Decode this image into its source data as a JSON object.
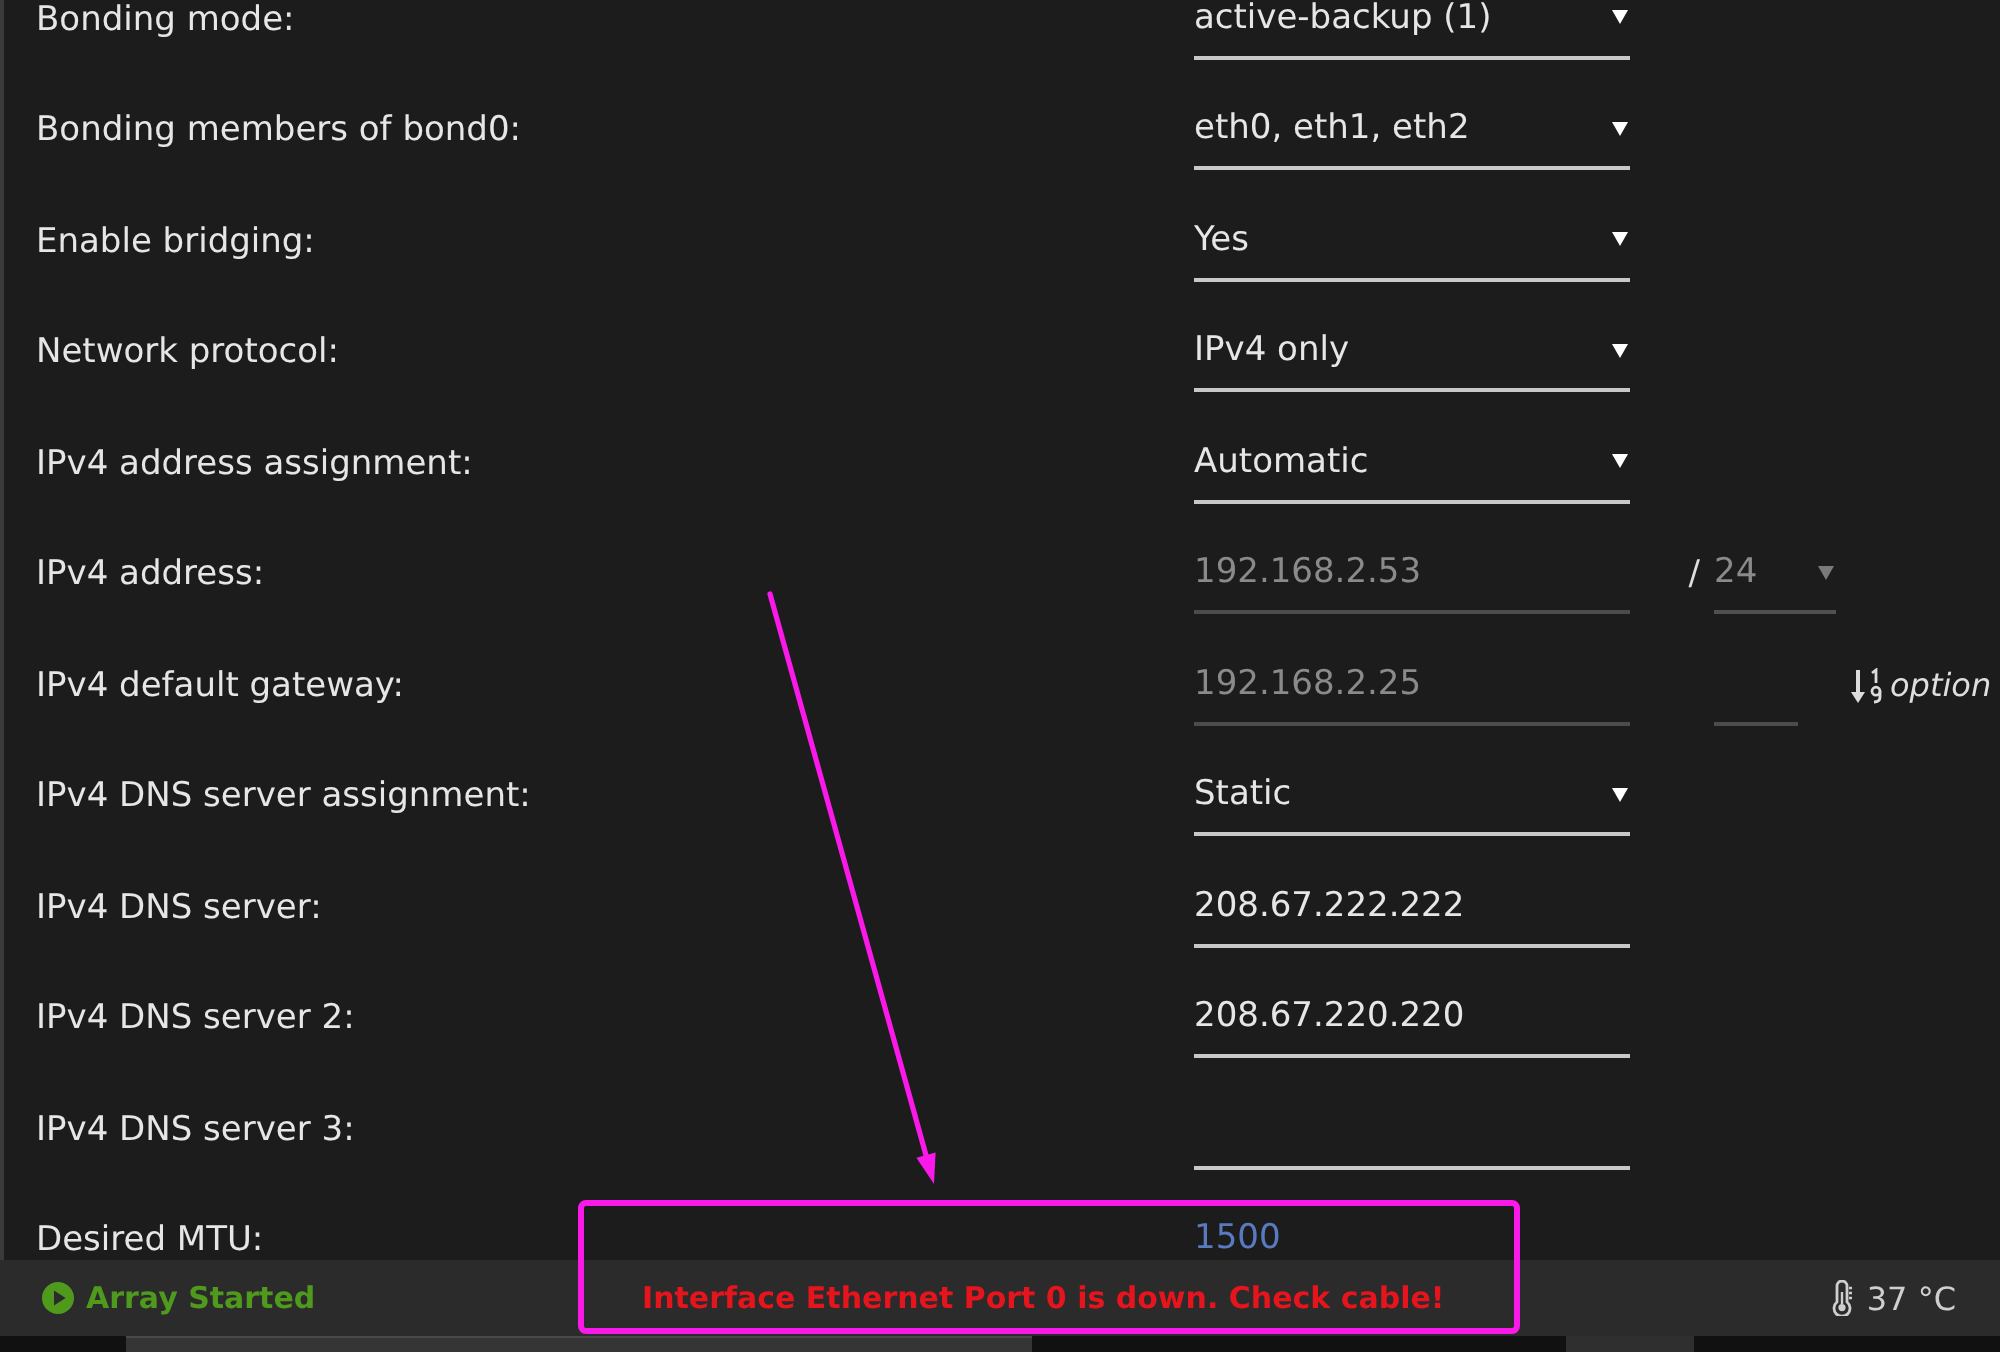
{
  "fields": [
    {
      "label": "Bonding mode:",
      "kind": "select",
      "value": "active-backup (1)",
      "disabled": false
    },
    {
      "label": "Bonding members of bond0:",
      "kind": "select",
      "value": "eth0, eth1, eth2",
      "disabled": false
    },
    {
      "label": "Enable bridging:",
      "kind": "select",
      "value": "Yes",
      "disabled": false
    },
    {
      "label": "Network protocol:",
      "kind": "select",
      "value": "IPv4 only",
      "disabled": false
    },
    {
      "label": "IPv4 address assignment:",
      "kind": "select",
      "value": "Automatic",
      "disabled": false
    },
    {
      "label": "IPv4 address:",
      "kind": "input",
      "value": "192.168.2.53",
      "disabled": true,
      "extras": [
        {
          "kind": "text",
          "text": "/"
        },
        {
          "kind": "select",
          "value": "24",
          "disabled": true
        }
      ]
    },
    {
      "label": "IPv4 default gateway:",
      "kind": "input",
      "value": "192.168.2.25",
      "disabled": true,
      "extras": [
        {
          "kind": "input",
          "disabled": true
        },
        {
          "kind": "sort-note",
          "text": "option"
        }
      ]
    },
    {
      "label": "IPv4 DNS server assignment:",
      "kind": "select",
      "value": "Static",
      "disabled": false
    },
    {
      "label": "IPv4 DNS server:",
      "kind": "input",
      "value": "208.67.222.222",
      "disabled": false
    },
    {
      "label": "IPv4 DNS server 2:",
      "kind": "input",
      "value": "208.67.220.220",
      "disabled": false
    },
    {
      "label": "IPv4 DNS server 3:",
      "kind": "input",
      "disabled": false
    },
    {
      "label": "Desired MTU:",
      "kind": "input",
      "placeholder": "1500",
      "disabled": false
    }
  ],
  "status_bar": {
    "array_status": "Array Started",
    "message": "Interface Ethernet Port 0 is down. Check cable!",
    "temperature": "37 °C"
  }
}
